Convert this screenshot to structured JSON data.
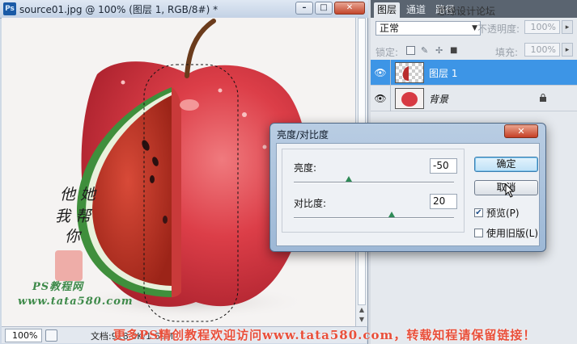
{
  "document": {
    "title": "source01.jpg @ 100% (图层 1, RGB/8#) *",
    "app_icon": "Ps",
    "buttons": {
      "minimize": "–",
      "maximize": "□",
      "close": "✕"
    },
    "zoom": "100%",
    "doc_info": "文档:918.8K/1.69M"
  },
  "panel": {
    "tabs": [
      "图层",
      "通道",
      "路径"
    ],
    "blend_mode": "正常",
    "opacity_label": "不透明度:",
    "opacity_value": "100%",
    "lock_label": "锁定:",
    "fill_label": "填充:",
    "fill_value": "100%",
    "layers": [
      {
        "name": "图层 1",
        "visible": true,
        "selected": true
      },
      {
        "name": "背景",
        "visible": true,
        "selected": false,
        "locked": true
      }
    ]
  },
  "dialog": {
    "title": "亮度/对比度",
    "close": "✕",
    "brightness_label": "亮度:",
    "brightness_value": "-50",
    "contrast_label": "对比度:",
    "contrast_value": "20",
    "ok_label": "确定",
    "cancel_label": "取消",
    "preview_label": "预览(P)",
    "preview_checked": true,
    "legacy_label": "使用旧版(L)",
    "legacy_checked": false
  },
  "watermarks": {
    "site_name": "PS教程网",
    "site_url": "www.tata580.com",
    "bottom_banner": "更多PS精创教程欢迎访问www.tata580.com，转载知程请保留链接！",
    "top_right": "思缘设计论坛"
  },
  "colors": {
    "selection": "#3d95e6",
    "apple_red": "#d93a43",
    "watermelon_rind": "#3f8f3c",
    "watermark_red": "#e94f3a"
  }
}
